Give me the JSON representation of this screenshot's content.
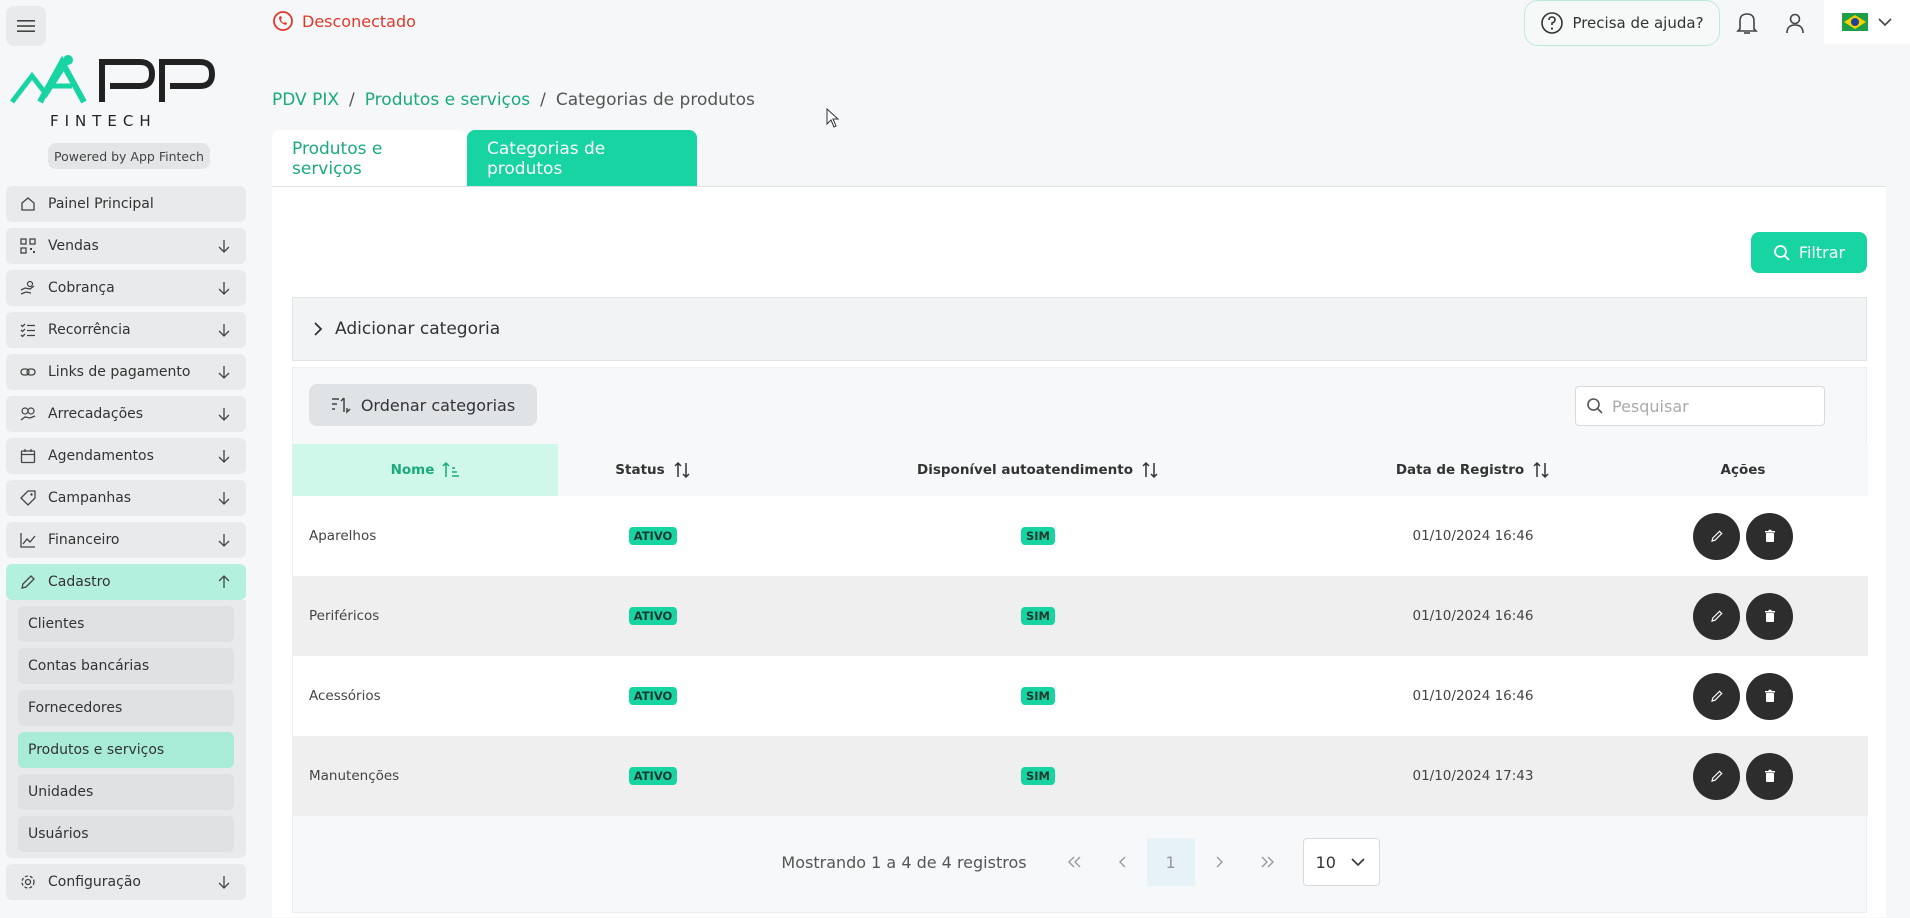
{
  "topbar": {
    "whatsapp_status": "Desconectado",
    "help_label": "Precisa de ajuda?"
  },
  "brand": {
    "logo_text": "APP",
    "logo_sub": "FINTECH",
    "powered_by": "Powered by App Fintech",
    "accent": "#17d4a2"
  },
  "sidebar": {
    "items": [
      {
        "label": "Painel Principal"
      },
      {
        "label": "Vendas"
      },
      {
        "label": "Cobrança"
      },
      {
        "label": "Recorrência"
      },
      {
        "label": "Links de pagamento"
      },
      {
        "label": "Arrecadações"
      },
      {
        "label": "Agendamentos"
      },
      {
        "label": "Campanhas"
      },
      {
        "label": "Financeiro"
      },
      {
        "label": "Cadastro"
      },
      {
        "label": "Configuração"
      }
    ],
    "cadastro_sub": [
      {
        "label": "Clientes"
      },
      {
        "label": "Contas bancárias"
      },
      {
        "label": "Fornecedores"
      },
      {
        "label": "Produtos e serviços"
      },
      {
        "label": "Unidades"
      },
      {
        "label": "Usuários"
      }
    ]
  },
  "breadcrumb": {
    "items": [
      "PDV PIX",
      "Produtos e serviços",
      "Categorias de produtos"
    ],
    "separator": "/"
  },
  "tabs": [
    {
      "label": "Produtos e serviços"
    },
    {
      "label": "Categorias de produtos"
    }
  ],
  "filter_label": "Filtrar",
  "accordion_label": "Adicionar categoria",
  "order_label": "Ordenar categorias",
  "search": {
    "placeholder": "Pesquisar"
  },
  "table": {
    "columns": [
      "Nome",
      "Status",
      "Disponível autoatendimento",
      "Data de Registro",
      "Ações"
    ],
    "rows": [
      {
        "name": "Aparelhos",
        "status": "ATIVO",
        "self_service": "SIM",
        "date": "01/10/2024 16:46"
      },
      {
        "name": "Periféricos",
        "status": "ATIVO",
        "self_service": "SIM",
        "date": "01/10/2024 16:46"
      },
      {
        "name": "Acessórios",
        "status": "ATIVO",
        "self_service": "SIM",
        "date": "01/10/2024 16:46"
      },
      {
        "name": "Manutenções",
        "status": "ATIVO",
        "self_service": "SIM",
        "date": "01/10/2024 17:43"
      }
    ]
  },
  "pagination": {
    "summary": "Mostrando 1 a 4 de 4 registros",
    "current_page": "1",
    "page_size": "10"
  }
}
